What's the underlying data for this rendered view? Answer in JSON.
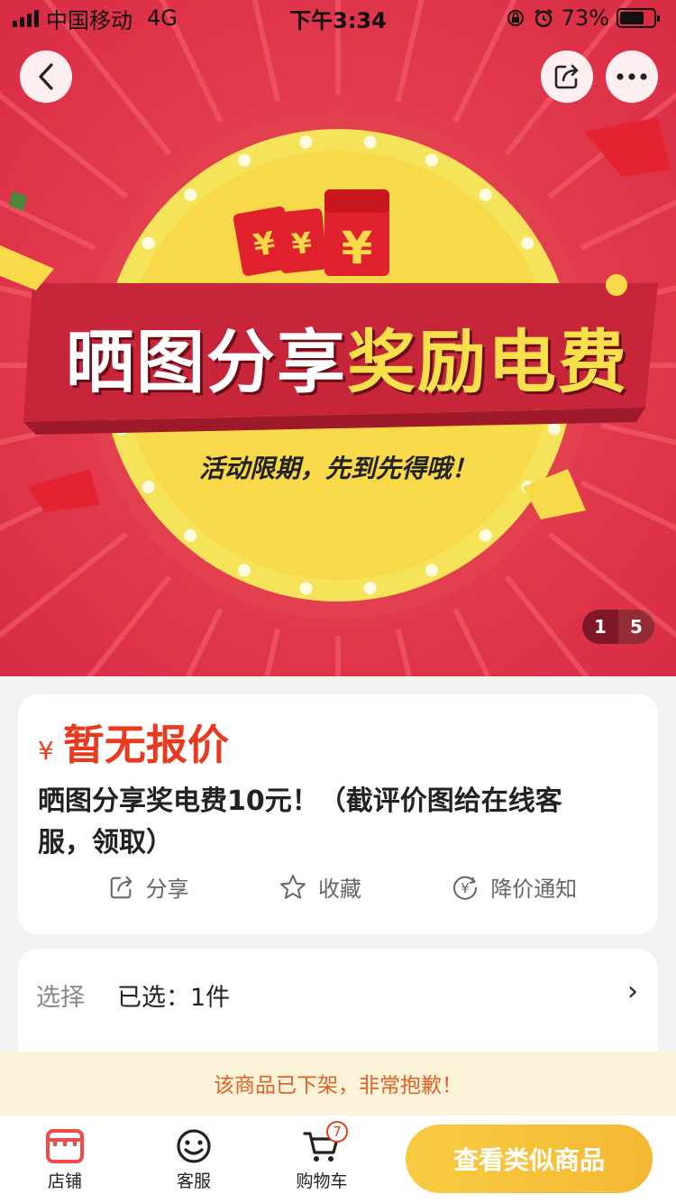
{
  "status_bar": {
    "carrier": "中国移动",
    "network": "4G",
    "time": "下午3:34",
    "battery": "73%",
    "battery_level": 0.73
  },
  "banner": {
    "headline_part1": "晒图分享",
    "headline_part2": "奖励电费",
    "subline": "活动限期，先到先得哦！",
    "coin_glyph": "¥",
    "pager_current": "1",
    "pager_total": "5",
    "colors": {
      "background": "#e0364a",
      "circle": "#f5e35a",
      "ribbon": "#c7263a",
      "accent": "#f7e04c"
    }
  },
  "product": {
    "price_symbol": "¥",
    "price_text": "暂无报价",
    "title": "晒图分享奖电费10元！（截评价图给在线客服，领取）",
    "actions": [
      {
        "label": "分享",
        "icon": "share-icon"
      },
      {
        "label": "收藏",
        "icon": "star-icon"
      },
      {
        "label": "降价通知",
        "icon": "price-drop-icon"
      }
    ]
  },
  "selection": {
    "label": "选择",
    "value": "已选：1件",
    "arrow": "›"
  },
  "notice": "该商品已下架，非常抱歉！",
  "bottom_bar": {
    "shop_label": "店铺",
    "cs_label": "客服",
    "cart_label": "购物车",
    "cart_count": "7",
    "cta_label": "查看类似商品"
  },
  "colors": {
    "price": "#e83a1e",
    "cta": "#f6c13a",
    "notice_bg": "#fbf3d8",
    "notice_text": "#e0622a"
  }
}
